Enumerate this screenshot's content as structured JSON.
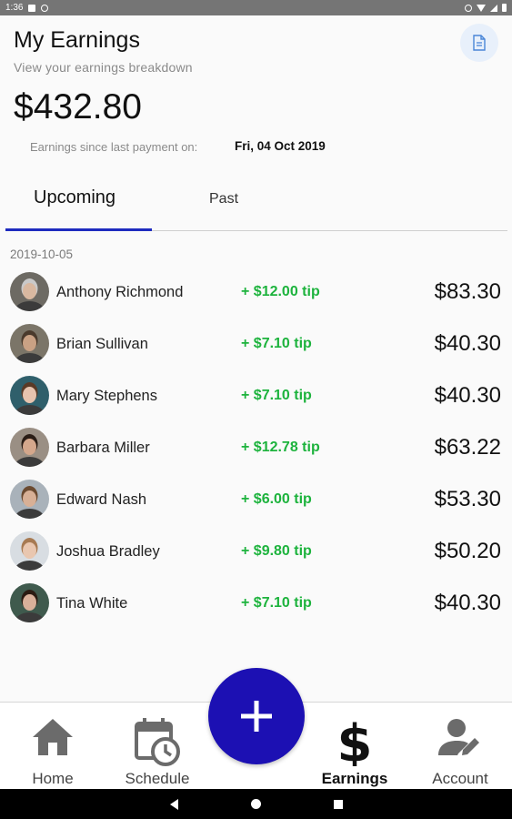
{
  "status_bar": {
    "time": "1:36"
  },
  "header": {
    "title": "My Earnings",
    "subtitle": "View your earnings breakdown",
    "doc_icon": "document-icon"
  },
  "summary": {
    "total": "$432.80",
    "since_label": "Earnings since last payment on:",
    "since_date": "Fri, 04 Oct 2019"
  },
  "tabs": [
    {
      "label": "Upcoming",
      "active": true
    },
    {
      "label": "Past",
      "active": false
    }
  ],
  "group_date": "2019-10-05",
  "earnings": [
    {
      "name": "Anthony Richmond",
      "tip": "+ $12.00 tip",
      "amount": "$83.30",
      "avatar_bg": "#6d6a63",
      "skin": "#d9b8a0",
      "hair": "#c9c9c9"
    },
    {
      "name": "Brian Sullivan",
      "tip": "+ $7.10 tip",
      "amount": "$40.30",
      "avatar_bg": "#7b7568",
      "skin": "#c9a184",
      "hair": "#4a3a2c"
    },
    {
      "name": "Mary Stephens",
      "tip": "+ $7.10 tip",
      "amount": "$40.30",
      "avatar_bg": "#2f5f6b",
      "skin": "#e6c3ae",
      "hair": "#5a3a26"
    },
    {
      "name": "Barbara Miller",
      "tip": "+ $12.78 tip",
      "amount": "$63.22",
      "avatar_bg": "#9a8f84",
      "skin": "#d4a78c",
      "hair": "#2a1d16"
    },
    {
      "name": "Edward Nash",
      "tip": "+ $6.00 tip",
      "amount": "$53.30",
      "avatar_bg": "#a9b2ba",
      "skin": "#d8b096",
      "hair": "#6b4a30"
    },
    {
      "name": "Joshua Bradley",
      "tip": "+ $9.80 tip",
      "amount": "$50.20",
      "avatar_bg": "#d8dde2",
      "skin": "#e9c7b0",
      "hair": "#a77a52"
    },
    {
      "name": "Tina White",
      "tip": "+ $7.10 tip",
      "amount": "$40.30",
      "avatar_bg": "#3f5a4d",
      "skin": "#d9b09a",
      "hair": "#2b1b12"
    }
  ],
  "bottom_nav": {
    "home": {
      "label": "Home",
      "icon": "home-icon"
    },
    "schedule": {
      "label": "Schedule",
      "icon": "calendar-clock-icon"
    },
    "add": {
      "icon": "plus-icon"
    },
    "earnings": {
      "label": "Earnings",
      "icon": "dollar-icon",
      "active": true
    },
    "account": {
      "label": "Account",
      "icon": "account-edit-icon"
    }
  },
  "colors": {
    "accent": "#1c10b3",
    "tab_indicator": "#1e2bbf",
    "tip_green": "#1db33d"
  }
}
